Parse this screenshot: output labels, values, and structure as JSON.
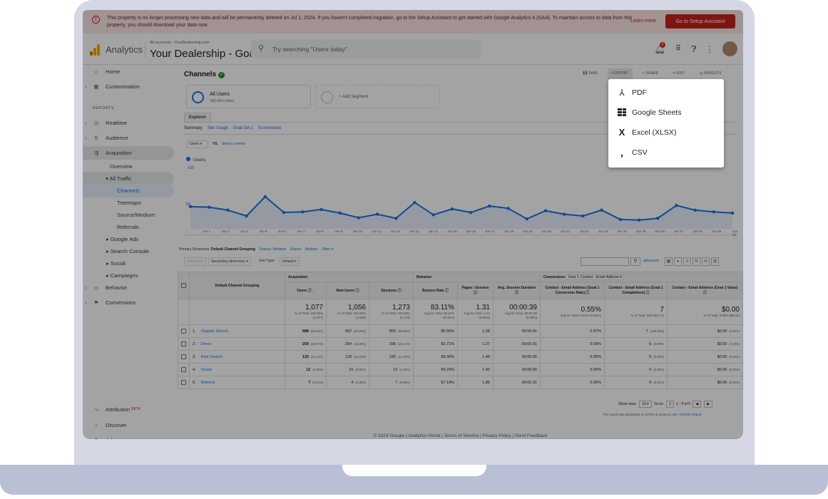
{
  "banner": {
    "message": "This property is no longer processing new data and will be permanently deleted on Jul 1, 2024. If you haven't completed migration, go to the Setup Assistant to get started with Google Analytics 4 (GA4). To maintain access to data from this property, you should download your data now.",
    "learn_more": "Learn more",
    "setup_button": "Go to Setup Assistant"
  },
  "header": {
    "app_name": "Analytics",
    "breadcrumb": "All accounts › YourDealership.com",
    "account_name": "Your Dealership - Goals",
    "search_placeholder": "Try searching \"Users today\"",
    "notification_count": "1"
  },
  "sidebar": {
    "reports_heading": "REPORTS",
    "items": [
      {
        "label": "Home",
        "icon": "home-icon"
      },
      {
        "label": "Customization",
        "icon": "dashboard-icon"
      },
      {
        "label": "Realtime",
        "icon": "clock-icon"
      },
      {
        "label": "Audience",
        "icon": "person-icon"
      },
      {
        "label": "Acquisition",
        "icon": "acquisition-icon"
      },
      {
        "label": "Overview"
      },
      {
        "label": "▾ All Traffic"
      },
      {
        "label": "Channels"
      },
      {
        "label": "Treemaps"
      },
      {
        "label": "Source/Medium"
      },
      {
        "label": "Referrals"
      },
      {
        "label": "▸ Google Ads"
      },
      {
        "label": "▸ Search Console"
      },
      {
        "label": "▸ Social"
      },
      {
        "label": "▸ Campaigns"
      },
      {
        "label": "Behavior",
        "icon": "behavior-icon"
      },
      {
        "label": "Conversions",
        "icon": "flag-icon"
      },
      {
        "label": "Attribution",
        "icon": "attribution-icon",
        "badge": "BETA"
      },
      {
        "label": "Discover",
        "icon": "lightbulb-icon"
      },
      {
        "label": "Admin",
        "icon": "gear-icon"
      }
    ]
  },
  "main": {
    "title": "Channels",
    "toolbar": {
      "save": "SAVE",
      "export": "EXPORT",
      "share": "SHARE",
      "edit": "EDIT",
      "insights": "INSIGHTS"
    },
    "segment_title": "All Users",
    "segment_sub": "100.00% Users",
    "add_segment": "+ Add Segment",
    "explorer_tab": "Explorer",
    "subtabs": [
      "Summary",
      "Site Usage",
      "Goal Set 1",
      "Ecommerce"
    ],
    "metric_select": "Users ▾",
    "vs": "VS.",
    "select_metric": "Select a metric",
    "legend_users": "Users",
    "y_label": "100",
    "y_mid": "50",
    "x_ticks": [
      "...",
      "Jun 2",
      "Jun 3",
      "Jun 4",
      "Jun 5",
      "Jun 6",
      "Jun 7",
      "Jun 8",
      "Jun 9",
      "Jun 10",
      "Jun 11",
      "Jun 12",
      "Jun 13",
      "Jun 14",
      "Jun 15",
      "Jun 16",
      "Jun 17",
      "Jun 18",
      "Jun 19",
      "Jun 20",
      "Jun 21",
      "Jun 22",
      "Jun 23",
      "Jun 24",
      "Jun 25",
      "Jun 26",
      "Jun 27",
      "Jun 28",
      "Jun 29",
      "Jun 30"
    ],
    "primary_dimension_label": "Primary Dimension:",
    "primary_dimension": "Default Channel Grouping",
    "dimension_links": [
      "Source / Medium",
      "Source",
      "Medium",
      "Other ▾"
    ],
    "plot_rows": "Plot Rows",
    "secondary_dimension": "Secondary dimension ▾",
    "sort_type_label": "Sort Type:",
    "sort_type": "Default ▾",
    "advanced": "advanced",
    "table": {
      "group_acquisition": "Acquisition",
      "group_behavior": "Behavior",
      "group_conversions": "Conversions",
      "goal_select": "Goal 1: Contact - Email Address ▾",
      "col_channel": "Default Channel Grouping",
      "cols": [
        "Users",
        "New Users",
        "Sessions",
        "Bounce Rate",
        "Pages / Session",
        "Avg. Session Duration",
        "Contact - Email Address (Goal 1 Conversion Rate)",
        "Contact - Email Address (Goal 1 Completions)",
        "Contact - Email Address (Goal 1 Value)"
      ],
      "totals": [
        {
          "big": "1,077",
          "small": "% of Total: 100.00% (1,077)"
        },
        {
          "big": "1,056",
          "small": "% of Total: 100.00% (1,056)"
        },
        {
          "big": "1,273",
          "small": "% of Total: 100.00% (1,273)"
        },
        {
          "big": "83.11%",
          "small": "Avg for View: 83.11% (0.00%)"
        },
        {
          "big": "1.31",
          "small": "Avg for View: 1.31 (0.00%)"
        },
        {
          "big": "00:00:39",
          "small": "Avg for View: 00:00:39 (0.00%)"
        },
        {
          "big": "0.55%",
          "small": "Avg for View: 0.55% (0.00%)"
        },
        {
          "big": "7",
          "small": "% of Total: 100.00% (7)"
        },
        {
          "big": "$0.00",
          "small": "% of Total: 0.00% ($0.00)"
        }
      ],
      "rows": [
        {
          "n": "1.",
          "name": "Organic Search",
          "users": "688",
          "users_pct": "(62.46%)",
          "new": "662",
          "new_pct": "(62.69%)",
          "sessions": "803",
          "sessions_pct": "(63.08%)",
          "bounce": "86.55%",
          "pps": "1.28",
          "dur": "00:00:41",
          "conv": "0.87%",
          "comp": "7",
          "comp_pct": "(100.00%)",
          "val": "$0.00",
          "val_pct": "(0.00%)"
        },
        {
          "n": "2.",
          "name": "Direct",
          "users": "259",
          "users_pct": "(23.57%)",
          "new": "254",
          "new_pct": "(24.05%)",
          "sessions": "295",
          "sessions_pct": "(23.17%)",
          "bounce": "82.71%",
          "pps": "1.27",
          "dur": "00:00:31",
          "conv": "0.00%",
          "comp": "0",
          "comp_pct": "(0.00%)",
          "val": "$0.00",
          "val_pct": "(0.00%)"
        },
        {
          "n": "3.",
          "name": "Paid Search",
          "users": "133",
          "users_pct": "(12.10%)",
          "new": "126",
          "new_pct": "(11.93%)",
          "sessions": "155",
          "sessions_pct": "(12.18%)",
          "bounce": "68.39%",
          "pps": "1.46",
          "dur": "00:00:36",
          "conv": "0.00%",
          "comp": "0",
          "comp_pct": "(0.00%)",
          "val": "$0.00",
          "val_pct": "(0.00%)"
        },
        {
          "n": "4.",
          "name": "Social",
          "users": "12",
          "users_pct": "(1.09%)",
          "new": "10",
          "new_pct": "(0.95%)",
          "sessions": "13",
          "sessions_pct": "(1.02%)",
          "bounce": "69.23%",
          "pps": "1.92",
          "dur": "00:00:56",
          "conv": "0.00%",
          "comp": "0",
          "comp_pct": "(0.00%)",
          "val": "$0.00",
          "val_pct": "(0.00%)"
        },
        {
          "n": "5.",
          "name": "Referral",
          "users": "7",
          "users_pct": "(0.64%)",
          "new": "4",
          "new_pct": "(0.38%)",
          "sessions": "7",
          "sessions_pct": "(0.55%)",
          "bounce": "57.14%",
          "pps": "1.86",
          "dur": "00:01:31",
          "conv": "0.00%",
          "comp": "0",
          "comp_pct": "(0.00%)",
          "val": "$0.00",
          "val_pct": "(0.00%)"
        }
      ]
    },
    "show_rows_label": "Show rows:",
    "show_rows_value": "10 ▾",
    "goto_label": "Go to:",
    "goto_value": "1",
    "range": "1 - 5 of 5",
    "generated_note": "This report was generated on 3/7/24 at 10:58:31 AM -",
    "refresh": "Refresh Report",
    "footer": "© 2024 Google | Analytics Home | Terms of Service | Privacy Policy | Send Feedback"
  },
  "export_menu": {
    "items": [
      {
        "label": "PDF",
        "icon": "pdf-icon"
      },
      {
        "label": "Google Sheets",
        "icon": "sheets-icon"
      },
      {
        "label": "Excel (XLSX)",
        "icon": "excel-icon"
      },
      {
        "label": "CSV",
        "icon": "csv-icon"
      }
    ]
  },
  "chart_data": {
    "type": "line",
    "x": [
      "Jun 1",
      "Jun 2",
      "Jun 3",
      "Jun 4",
      "Jun 5",
      "Jun 6",
      "Jun 7",
      "Jun 8",
      "Jun 9",
      "Jun 10",
      "Jun 11",
      "Jun 12",
      "Jun 13",
      "Jun 14",
      "Jun 15",
      "Jun 16",
      "Jun 17",
      "Jun 18",
      "Jun 19",
      "Jun 20",
      "Jun 21",
      "Jun 22",
      "Jun 23",
      "Jun 24",
      "Jun 25",
      "Jun 26",
      "Jun 27",
      "Jun 28",
      "Jun 29",
      "Jun 30"
    ],
    "series": [
      {
        "name": "Users",
        "values": [
          38,
          37,
          32,
          22,
          55,
          28,
          29,
          33,
          27,
          19,
          25,
          18,
          45,
          24,
          34,
          28,
          39,
          35,
          17,
          31,
          25,
          22,
          32,
          16,
          15,
          18,
          40,
          32,
          29,
          27
        ]
      }
    ],
    "ylim": [
      0,
      100
    ],
    "color": "#1a73e8"
  }
}
